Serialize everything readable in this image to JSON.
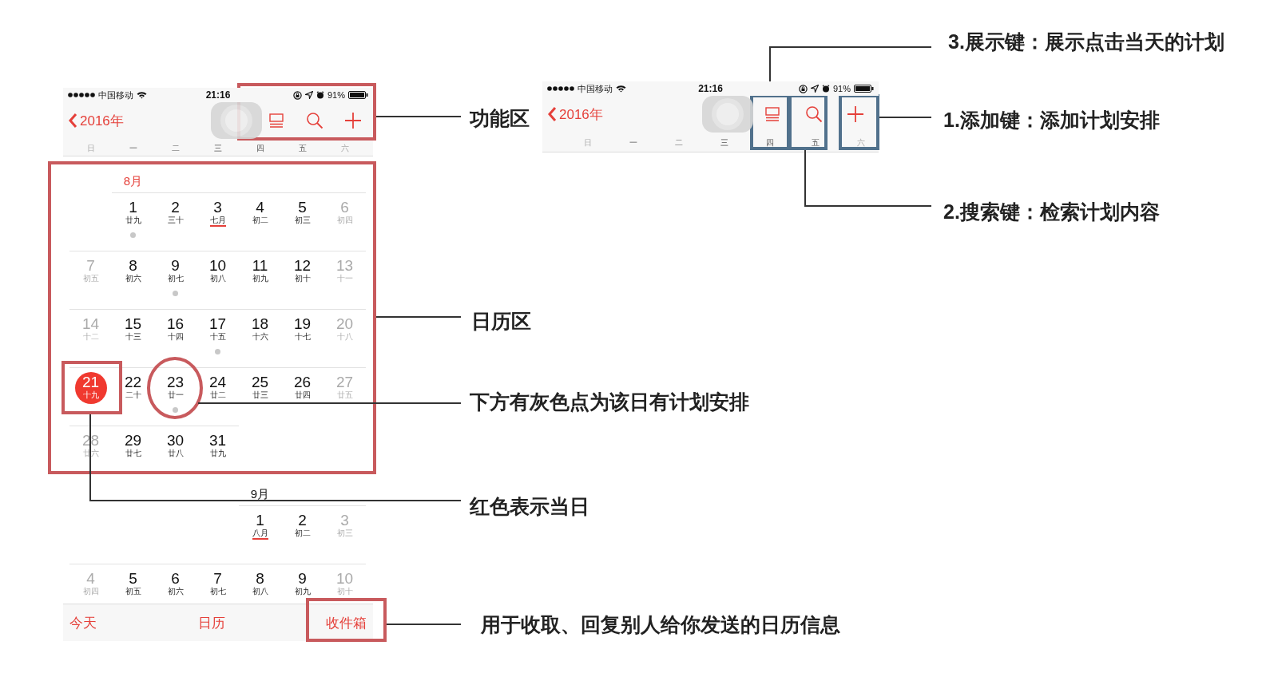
{
  "phone": {
    "status_bar": {
      "carrier": "中国移动",
      "time": "21:16",
      "battery": "91%"
    },
    "nav": {
      "back": "2016年"
    },
    "weekdays": [
      {
        "label": "日",
        "weekend": true
      },
      {
        "label": "一",
        "weekend": false
      },
      {
        "label": "二",
        "weekend": false
      },
      {
        "label": "三",
        "weekend": false
      },
      {
        "label": "四",
        "weekend": false
      },
      {
        "label": "五",
        "weekend": false
      },
      {
        "label": "六",
        "weekend": true
      }
    ],
    "months": [
      {
        "label": "8月",
        "weeks": [
          [
            {
              "kind": "blank"
            },
            {
              "kind": "day",
              "day": "1",
              "lunar": "廿九",
              "weekend": false,
              "event": true,
              "today": false,
              "lunar_month_start": false
            },
            {
              "kind": "day",
              "day": "2",
              "lunar": "三十",
              "weekend": false,
              "event": false,
              "today": false,
              "lunar_month_start": false
            },
            {
              "kind": "day",
              "day": "3",
              "lunar": "七月",
              "weekend": false,
              "event": false,
              "today": false,
              "lunar_month_start": true
            },
            {
              "kind": "day",
              "day": "4",
              "lunar": "初二",
              "weekend": false,
              "event": false,
              "today": false,
              "lunar_month_start": false
            },
            {
              "kind": "day",
              "day": "5",
              "lunar": "初三",
              "weekend": false,
              "event": false,
              "today": false,
              "lunar_month_start": false
            },
            {
              "kind": "day",
              "day": "6",
              "lunar": "初四",
              "weekend": true,
              "event": false,
              "today": false,
              "lunar_month_start": false
            }
          ],
          [
            {
              "kind": "day",
              "day": "7",
              "lunar": "初五",
              "weekend": true,
              "event": false,
              "today": false,
              "lunar_month_start": false
            },
            {
              "kind": "day",
              "day": "8",
              "lunar": "初六",
              "weekend": false,
              "event": false,
              "today": false,
              "lunar_month_start": false
            },
            {
              "kind": "day",
              "day": "9",
              "lunar": "初七",
              "weekend": false,
              "event": true,
              "today": false,
              "lunar_month_start": false
            },
            {
              "kind": "day",
              "day": "10",
              "lunar": "初八",
              "weekend": false,
              "event": false,
              "today": false,
              "lunar_month_start": false
            },
            {
              "kind": "day",
              "day": "11",
              "lunar": "初九",
              "weekend": false,
              "event": false,
              "today": false,
              "lunar_month_start": false
            },
            {
              "kind": "day",
              "day": "12",
              "lunar": "初十",
              "weekend": false,
              "event": false,
              "today": false,
              "lunar_month_start": false
            },
            {
              "kind": "day",
              "day": "13",
              "lunar": "十一",
              "weekend": true,
              "event": false,
              "today": false,
              "lunar_month_start": false
            }
          ],
          [
            {
              "kind": "day",
              "day": "14",
              "lunar": "十二",
              "weekend": true,
              "event": false,
              "today": false,
              "lunar_month_start": false
            },
            {
              "kind": "day",
              "day": "15",
              "lunar": "十三",
              "weekend": false,
              "event": false,
              "today": false,
              "lunar_month_start": false
            },
            {
              "kind": "day",
              "day": "16",
              "lunar": "十四",
              "weekend": false,
              "event": false,
              "today": false,
              "lunar_month_start": false
            },
            {
              "kind": "day",
              "day": "17",
              "lunar": "十五",
              "weekend": false,
              "event": true,
              "today": false,
              "lunar_month_start": false
            },
            {
              "kind": "day",
              "day": "18",
              "lunar": "十六",
              "weekend": false,
              "event": false,
              "today": false,
              "lunar_month_start": false
            },
            {
              "kind": "day",
              "day": "19",
              "lunar": "十七",
              "weekend": false,
              "event": false,
              "today": false,
              "lunar_month_start": false
            },
            {
              "kind": "day",
              "day": "20",
              "lunar": "十八",
              "weekend": true,
              "event": false,
              "today": false,
              "lunar_month_start": false
            }
          ],
          [
            {
              "kind": "day",
              "day": "21",
              "lunar": "十九",
              "weekend": true,
              "event": false,
              "today": true,
              "lunar_month_start": false
            },
            {
              "kind": "day",
              "day": "22",
              "lunar": "二十",
              "weekend": false,
              "event": false,
              "today": false,
              "lunar_month_start": false
            },
            {
              "kind": "day",
              "day": "23",
              "lunar": "廿一",
              "weekend": false,
              "event": true,
              "today": false,
              "lunar_month_start": false
            },
            {
              "kind": "day",
              "day": "24",
              "lunar": "廿二",
              "weekend": false,
              "event": false,
              "today": false,
              "lunar_month_start": false
            },
            {
              "kind": "day",
              "day": "25",
              "lunar": "廿三",
              "weekend": false,
              "event": false,
              "today": false,
              "lunar_month_start": false
            },
            {
              "kind": "day",
              "day": "26",
              "lunar": "廿四",
              "weekend": false,
              "event": false,
              "today": false,
              "lunar_month_start": false
            },
            {
              "kind": "day",
              "day": "27",
              "lunar": "廿五",
              "weekend": true,
              "event": false,
              "today": false,
              "lunar_month_start": false
            }
          ],
          [
            {
              "kind": "day",
              "day": "28",
              "lunar": "廿六",
              "weekend": true,
              "event": false,
              "today": false,
              "lunar_month_start": false
            },
            {
              "kind": "day",
              "day": "29",
              "lunar": "廿七",
              "weekend": false,
              "event": false,
              "today": false,
              "lunar_month_start": false
            },
            {
              "kind": "day",
              "day": "30",
              "lunar": "廿八",
              "weekend": false,
              "event": false,
              "today": false,
              "lunar_month_start": false
            },
            {
              "kind": "day",
              "day": "31",
              "lunar": "廿九",
              "weekend": false,
              "event": false,
              "today": false,
              "lunar_month_start": false
            }
          ]
        ]
      },
      {
        "label": "9月",
        "weeks": [
          [
            {
              "kind": "blank"
            },
            {
              "kind": "blank"
            },
            {
              "kind": "blank"
            },
            {
              "kind": "blank"
            },
            {
              "kind": "day",
              "day": "1",
              "lunar": "八月",
              "weekend": false,
              "event": false,
              "today": false,
              "lunar_month_start": true
            },
            {
              "kind": "day",
              "day": "2",
              "lunar": "初二",
              "weekend": false,
              "event": false,
              "today": false,
              "lunar_month_start": false
            },
            {
              "kind": "day",
              "day": "3",
              "lunar": "初三",
              "weekend": true,
              "event": false,
              "today": false,
              "lunar_month_start": false
            }
          ],
          [
            {
              "kind": "day",
              "day": "4",
              "lunar": "初四",
              "weekend": true,
              "event": false,
              "today": false,
              "lunar_month_start": false
            },
            {
              "kind": "day",
              "day": "5",
              "lunar": "初五",
              "weekend": false,
              "event": false,
              "today": false,
              "lunar_month_start": false
            },
            {
              "kind": "day",
              "day": "6",
              "lunar": "初六",
              "weekend": false,
              "event": false,
              "today": false,
              "lunar_month_start": false
            },
            {
              "kind": "day",
              "day": "7",
              "lunar": "初七",
              "weekend": false,
              "event": false,
              "today": false,
              "lunar_month_start": false
            },
            {
              "kind": "day",
              "day": "8",
              "lunar": "初八",
              "weekend": false,
              "event": false,
              "today": false,
              "lunar_month_start": false
            },
            {
              "kind": "day",
              "day": "9",
              "lunar": "初九",
              "weekend": false,
              "event": false,
              "today": false,
              "lunar_month_start": false
            },
            {
              "kind": "day",
              "day": "10",
              "lunar": "初十",
              "weekend": true,
              "event": false,
              "today": false,
              "lunar_month_start": false
            }
          ]
        ]
      }
    ],
    "tab_bar": [
      {
        "label": "今天"
      },
      {
        "label": "日历"
      },
      {
        "label": "收件箱"
      }
    ]
  },
  "detail": {
    "status_bar": {
      "carrier": "中国移动",
      "time": "21:16",
      "battery": "91%"
    },
    "nav": {
      "back": "2016年"
    },
    "weekdays": [
      {
        "label": "日",
        "weekend": true
      },
      {
        "label": "一",
        "weekend": false
      },
      {
        "label": "二",
        "weekend": false
      },
      {
        "label": "三",
        "weekend": false
      },
      {
        "label": "四",
        "weekend": false
      },
      {
        "label": "五",
        "weekend": false
      },
      {
        "label": "六",
        "weekend": true
      }
    ]
  },
  "annotations": [
    {
      "text": "3.展示键：展示点击当天的计划"
    },
    {
      "text": "功能区"
    },
    {
      "text": "1.添加键：添加计划安排"
    },
    {
      "text": "2.搜索键：检索计划内容"
    },
    {
      "text": "日历区"
    },
    {
      "text": "下方有灰色点为该日有计划安排"
    },
    {
      "text": "红色表示当日"
    },
    {
      "text": "用于收取、回复别人给你发送的日历信息"
    }
  ]
}
